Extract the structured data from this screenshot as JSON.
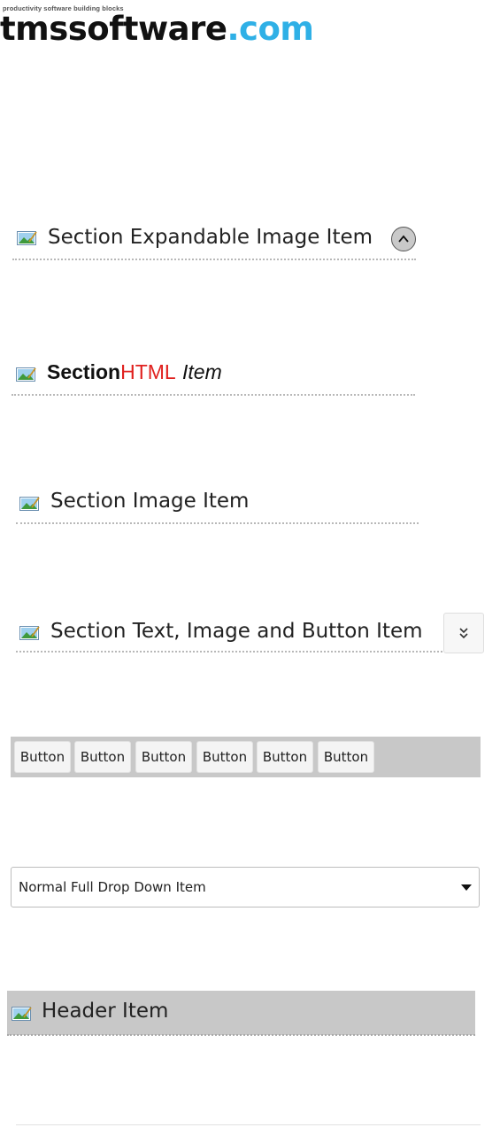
{
  "logo": {
    "tagline": "productivity software building blocks",
    "main": "tmssoftware",
    "domain": ".com",
    "accent_color": "#2fb0e6"
  },
  "items": {
    "expandable": {
      "label": "Section Expandable Image Item",
      "icon": "image-icon",
      "button_icon": "chevron-up-icon"
    },
    "html": {
      "part_bold": "Section",
      "part_red": "HTML",
      "part_italic": "Item",
      "red_color": "#e0201e",
      "icon": "image-icon"
    },
    "image": {
      "label": "Section Image Item",
      "icon": "image-icon"
    },
    "text_image_button": {
      "label": "Section Text, Image and Button Item",
      "icon": "image-icon",
      "button_icon": "double-chevron-down-icon"
    }
  },
  "button_bar": {
    "buttons": [
      "Button",
      "Button",
      "Button",
      "Button",
      "Button",
      "Button"
    ],
    "background": "#c8c8c8"
  },
  "dropdown": {
    "value": "Normal Full Drop Down Item"
  },
  "header": {
    "label": "Header Item",
    "icon": "image-icon",
    "background": "#c8c8c8"
  }
}
